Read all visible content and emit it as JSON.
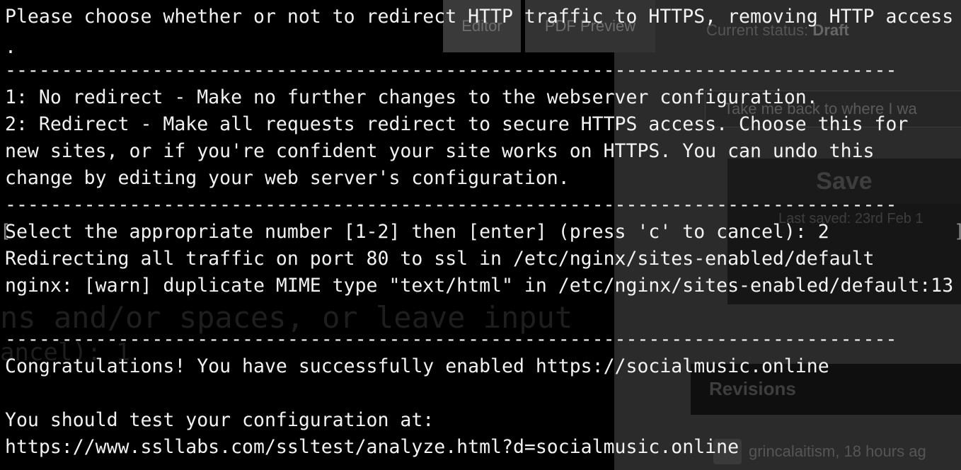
{
  "background_app": {
    "tabs": [
      "Editor",
      "PDF Preview"
    ],
    "status_label": "Current status:",
    "status_value": "Draft",
    "back_link": "Take me back to where I wa",
    "save_button": "Save",
    "last_saved": "Last saved: 23rd Feb 1",
    "revisions_heading": "Revisions",
    "revision_item": "grincalaitism, 18 hours ag",
    "ghost_text": {
      "line1": "ns and/or spaces, or leave input",
      "line2": "ancel): 1"
    }
  },
  "terminal": {
    "lines": [
      "Please choose whether or not to redirect HTTP traffic to HTTPS, removing HTTP access",
      ".",
      "-------------------------------------------------------------------------------",
      "1: No redirect - Make no further changes to the webserver configuration.",
      "2: Redirect - Make all requests redirect to secure HTTPS access. Choose this for",
      "new sites, or if you're confident your site works on HTTPS. You can undo this",
      "change by editing your web server's configuration.",
      "-------------------------------------------------------------------------------",
      "Select the appropriate number [1-2] then [enter] (press 'c' to cancel): 2",
      "Redirecting all traffic on port 80 to ssl in /etc/nginx/sites-enabled/default",
      "nginx: [warn] duplicate MIME type \"text/html\" in /etc/nginx/sites-enabled/default:13",
      "",
      "-------------------------------------------------------------------------------",
      "Congratulations! You have successfully enabled https://socialmusic.online",
      "",
      "You should test your configuration at:",
      "https://www.ssllabs.com/ssltest/analyze.html?d=socialmusic.online"
    ]
  },
  "colors": {
    "terminal_text": "#f2f2f2",
    "terminal_bg": "#000000",
    "side_panel": "#2b2b2b"
  }
}
